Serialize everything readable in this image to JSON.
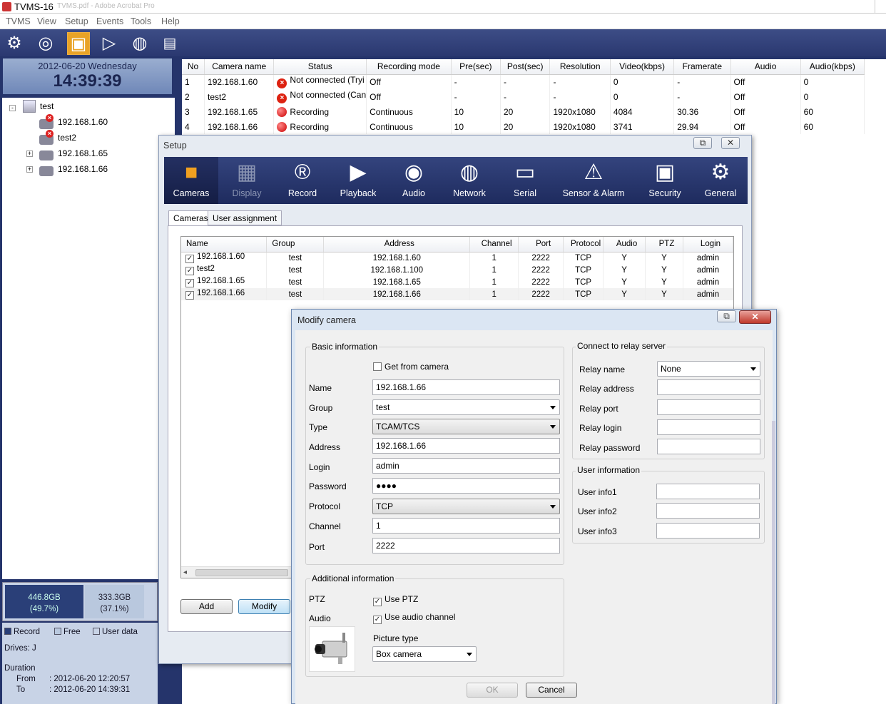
{
  "app": {
    "title": "TVMS-16",
    "ghost_title": "TVMS.pdf - Adobe Acrobat Pro"
  },
  "menu": [
    "TVMS",
    "View",
    "Setup",
    "Events",
    "Tools",
    "Help"
  ],
  "toolbar": {
    "icons": [
      "gear-icon",
      "disk-icon",
      "film-icon",
      "play-icon",
      "globe-icon",
      "document-icon"
    ]
  },
  "clock": {
    "date": "2012-06-20 Wednesday",
    "time": "14:39:39"
  },
  "tree": {
    "root": "test",
    "items": [
      "192.168.1.60",
      "test2",
      "192.168.1.65",
      "192.168.1.66"
    ]
  },
  "storage": {
    "record": {
      "size": "446.8GB",
      "pct": "(49.7%)"
    },
    "free": {
      "size": "333.3GB",
      "pct": "(37.1%)"
    }
  },
  "legend": {
    "record": "Record",
    "free": "Free",
    "user": "User data"
  },
  "drives": "Drives: J",
  "duration": {
    "label": "Duration",
    "from_label": "From",
    "from": ": 2012-06-20 12:20:57",
    "to_label": "To",
    "to": ": 2012-06-20 14:39:31"
  },
  "main_grid": {
    "headers": [
      "No",
      "Camera name",
      "Status",
      "Recording mode",
      "Pre(sec)",
      "Post(sec)",
      "Resolution",
      "Video(kbps)",
      "Framerate",
      "Audio",
      "Audio(kbps)"
    ],
    "rows": [
      [
        "1",
        "192.168.1.60",
        "Not connected (Tryi",
        "Off",
        "-",
        "-",
        "-",
        "0",
        "-",
        "Off",
        "0"
      ],
      [
        "2",
        "test2",
        "Not connected (Can",
        "Off",
        "-",
        "-",
        "-",
        "0",
        "-",
        "Off",
        "0"
      ],
      [
        "3",
        "192.168.1.65",
        "Recording",
        "Continuous",
        "10",
        "20",
        "1920x1080",
        "4084",
        "30.36",
        "Off",
        "60"
      ],
      [
        "4",
        "192.168.1.66",
        "Recording",
        "Continuous",
        "10",
        "20",
        "1920x1080",
        "3741",
        "29.94",
        "Off",
        "60"
      ]
    ]
  },
  "setup": {
    "title": "Setup",
    "nav": [
      {
        "label": "Cameras",
        "icon": "camera-icon"
      },
      {
        "label": "Display",
        "icon": "display-icon"
      },
      {
        "label": "Record",
        "icon": "record-icon"
      },
      {
        "label": "Playback",
        "icon": "playback-icon"
      },
      {
        "label": "Audio",
        "icon": "speaker-icon"
      },
      {
        "label": "Network",
        "icon": "globe-icon"
      },
      {
        "label": "Serial",
        "icon": "serial-port-icon"
      },
      {
        "label": "Sensor & Alarm",
        "icon": "warning-icon"
      },
      {
        "label": "Security",
        "icon": "lock-icon"
      },
      {
        "label": "General",
        "icon": "gear-icon"
      }
    ],
    "tabs": [
      "Cameras",
      "User assignment"
    ],
    "cam_table": {
      "headers": [
        "Name",
        "Group",
        "Address",
        "Channel",
        "Port",
        "Protocol",
        "Audio",
        "PTZ",
        "Login"
      ],
      "rows": [
        [
          "192.168.1.60",
          "test",
          "192.168.1.60",
          "1",
          "2222",
          "TCP",
          "Y",
          "Y",
          "admin"
        ],
        [
          "test2",
          "test",
          "192.168.1.100",
          "1",
          "2222",
          "TCP",
          "Y",
          "Y",
          "admin"
        ],
        [
          "192.168.1.65",
          "test",
          "192.168.1.65",
          "1",
          "2222",
          "TCP",
          "Y",
          "Y",
          "admin"
        ],
        [
          "192.168.1.66",
          "test",
          "192.168.1.66",
          "1",
          "2222",
          "TCP",
          "Y",
          "Y",
          "admin"
        ]
      ]
    },
    "add_label": "Add",
    "modify_label": "Modify"
  },
  "modify": {
    "title": "Modify camera",
    "basic_label": "Basic information",
    "get_from_camera": "Get from camera",
    "fields": {
      "name": {
        "label": "Name",
        "value": "192.168.1.66"
      },
      "group": {
        "label": "Group",
        "value": "test"
      },
      "type": {
        "label": "Type",
        "value": "TCAM/TCS"
      },
      "address": {
        "label": "Address",
        "value": "192.168.1.66"
      },
      "login": {
        "label": "Login",
        "value": "admin"
      },
      "password": {
        "label": "Password",
        "value": "●●●●"
      },
      "protocol": {
        "label": "Protocol",
        "value": "TCP"
      },
      "channel": {
        "label": "Channel",
        "value": "1"
      },
      "port": {
        "label": "Port",
        "value": "2222"
      }
    },
    "additional_label": "Additional information",
    "ptz_label": "PTZ",
    "use_ptz": "Use PTZ",
    "audio_label": "Audio",
    "use_audio": "Use audio channel",
    "picture_type_label": "Picture type",
    "picture_type": "Box camera",
    "relay_label": "Connect to relay server",
    "relay": {
      "name_label": "Relay name",
      "name_value": "None",
      "address_label": "Relay address",
      "port_label": "Relay port",
      "login_label": "Relay login",
      "password_label": "Relay password"
    },
    "user_info_label": "User information",
    "user_info": [
      "User info1",
      "User info2",
      "User info3"
    ],
    "ok": "OK",
    "cancel": "Cancel"
  }
}
